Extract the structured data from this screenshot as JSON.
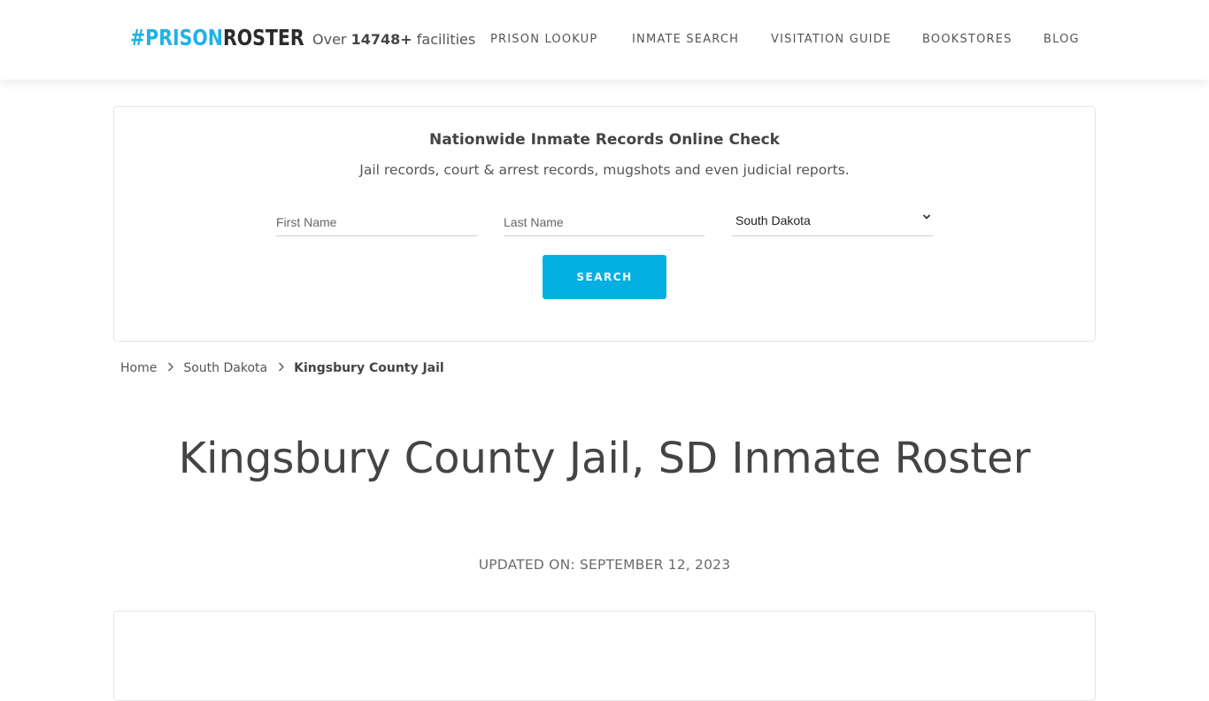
{
  "header": {
    "logo": {
      "hash_part": "#PRISON",
      "roster_part": "ROSTER"
    },
    "facilities": {
      "prefix": "Over",
      "count": "14748+",
      "suffix": "facilities"
    },
    "nav": [
      {
        "label": "PRISON LOOKUP"
      },
      {
        "label": "INMATE SEARCH"
      },
      {
        "label": "VISITATION GUIDE"
      },
      {
        "label": "BOOKSTORES"
      },
      {
        "label": "BLOG"
      }
    ]
  },
  "search": {
    "title": "Nationwide Inmate Records Online Check",
    "subtitle": "Jail records, court & arrest records, mugshots and even judicial reports.",
    "first_name_placeholder": "First Name",
    "last_name_placeholder": "Last Name",
    "state_selected": "South Dakota",
    "button_label": "SEARCH"
  },
  "breadcrumb": {
    "items": [
      {
        "label": "Home"
      },
      {
        "label": "South Dakota"
      },
      {
        "label": "Kingsbury County Jail"
      }
    ]
  },
  "page": {
    "title": "Kingsbury County Jail, SD Inmate Roster",
    "updated": "UPDATED ON: SEPTEMBER 12, 2023"
  },
  "colors": {
    "brand_blue": "#1fb3e5",
    "button_blue": "#03b0e1",
    "text_dark": "#444444"
  }
}
